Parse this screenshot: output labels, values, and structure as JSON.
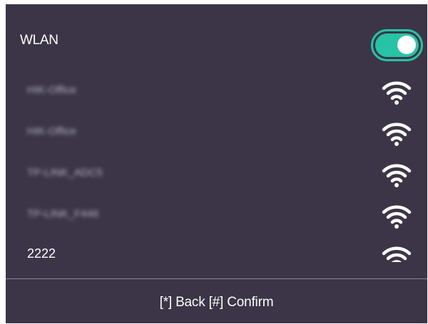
{
  "wlan": {
    "label": "WLAN",
    "toggle_state": "on",
    "accent_color": "#27c3a6"
  },
  "networks": [
    {
      "name": "HIK-Office",
      "icon": "wifi-icon"
    },
    {
      "name": "HIK-Office",
      "icon": "wifi-icon"
    },
    {
      "name": "TP-LINK_ADC5",
      "icon": "wifi-icon"
    },
    {
      "name": "TP-LINK_F446",
      "icon": "wifi-icon"
    },
    {
      "name": "2222",
      "icon": "wifi-icon"
    }
  ],
  "footer": {
    "hint": "[*] Back [#] Confirm"
  },
  "colors": {
    "background": "#3b3547",
    "text": "#ffffff"
  }
}
